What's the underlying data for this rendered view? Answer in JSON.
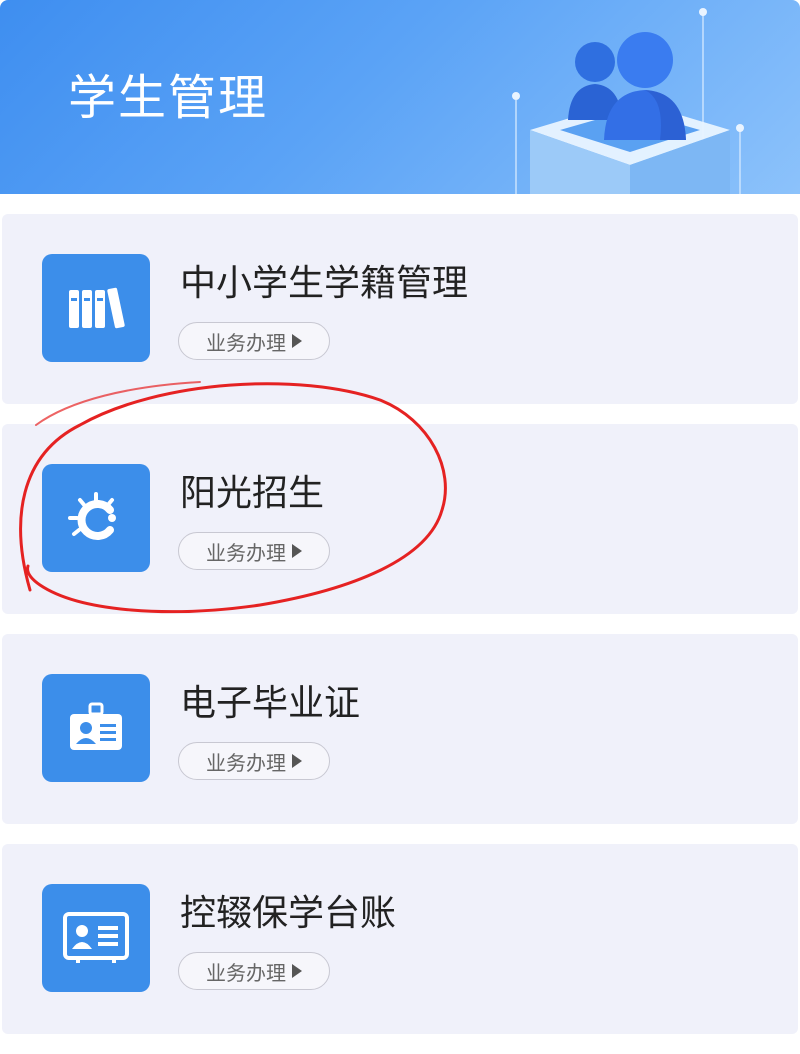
{
  "header": {
    "title": "学生管理",
    "illustration": "users-pedestal-illustration"
  },
  "services": [
    {
      "title": "中小学生学籍管理",
      "icon": "books-icon",
      "action_label": "业务办理"
    },
    {
      "title": "阳光招生",
      "icon": "sunshine-icon",
      "action_label": "业务办理"
    },
    {
      "title": "电子毕业证",
      "icon": "id-badge-icon",
      "action_label": "业务办理"
    },
    {
      "title": "控辍保学台账",
      "icon": "id-card-icon",
      "action_label": "业务办理"
    }
  ],
  "annotation": {
    "type": "hand-drawn circle",
    "target": "阳光招生",
    "color": "#e52222"
  },
  "colors": {
    "accent": "#3c8eea",
    "card_bg": "#f0f1fa",
    "header_gradient_start": "#3e8ef0",
    "header_gradient_end": "#8cc2fb"
  }
}
